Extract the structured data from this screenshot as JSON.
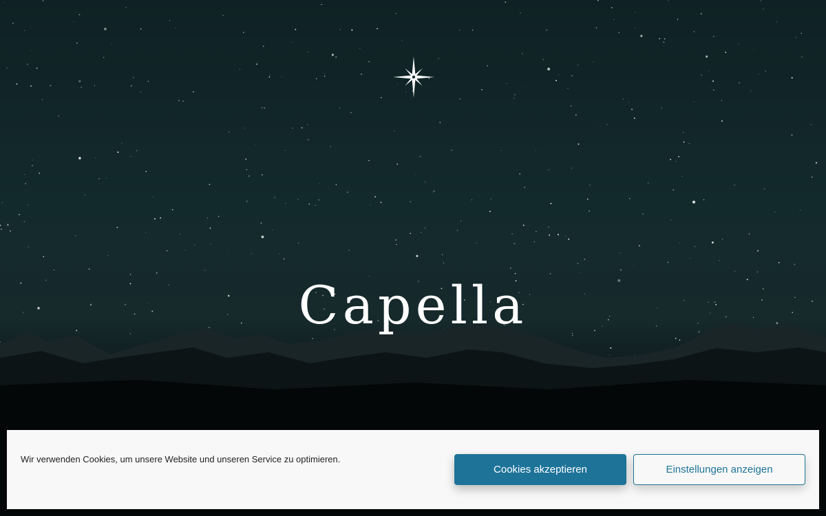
{
  "hero": {
    "title": "Capella",
    "logo_icon": "compass-star-icon"
  },
  "cookie_banner": {
    "message": "Wir verwenden Cookies, um unsere Website und unseren Service zu optimieren.",
    "accept_label": "Cookies akzeptieren",
    "settings_label": "Einstellungen anzeigen"
  },
  "colors": {
    "accent": "#1e7399",
    "banner_background": "#f8f8f8",
    "sky": "#132a2d"
  }
}
